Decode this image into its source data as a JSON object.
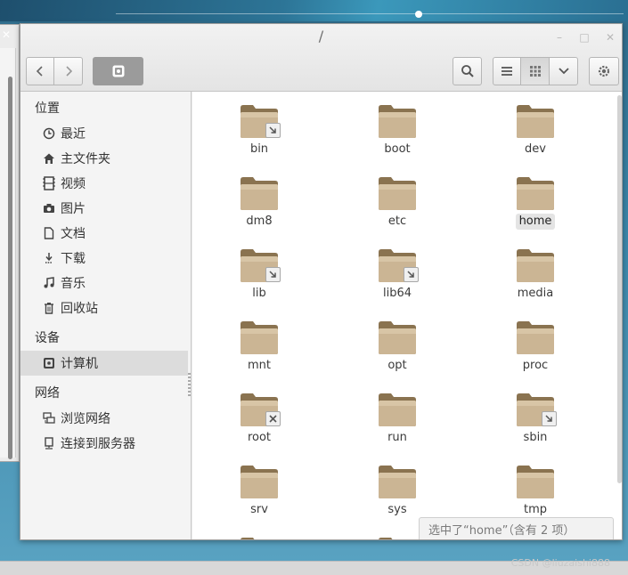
{
  "window": {
    "title": "/"
  },
  "toolbar": {
    "back_icon": "chevron-left-icon",
    "forward_icon": "chevron-right-icon",
    "path_button_icon": "computer-drive-icon",
    "search_icon": "search-icon",
    "list_view_icon": "list-view-icon",
    "grid_view_icon": "grid-view-icon",
    "view_options_icon": "chevron-down-icon",
    "settings_icon": "gear-icon",
    "active_view": "grid"
  },
  "sidebar": {
    "sections": [
      {
        "heading": "位置",
        "items": [
          {
            "label": "最近",
            "icon": "clock-icon"
          },
          {
            "label": "主文件夹",
            "icon": "home-icon"
          },
          {
            "label": "视频",
            "icon": "film-icon"
          },
          {
            "label": "图片",
            "icon": "camera-icon"
          },
          {
            "label": "文档",
            "icon": "document-icon"
          },
          {
            "label": "下载",
            "icon": "download-icon"
          },
          {
            "label": "音乐",
            "icon": "music-icon"
          },
          {
            "label": "回收站",
            "icon": "trash-icon"
          }
        ]
      },
      {
        "heading": "设备",
        "items": [
          {
            "label": "计算机",
            "icon": "computer-drive-icon",
            "selected": true
          }
        ]
      },
      {
        "heading": "网络",
        "items": [
          {
            "label": "浏览网络",
            "icon": "network-icon"
          },
          {
            "label": "连接到服务器",
            "icon": "server-icon"
          }
        ]
      }
    ]
  },
  "files": [
    {
      "name": "bin",
      "emblem": "symlink-icon"
    },
    {
      "name": "boot",
      "emblem": ""
    },
    {
      "name": "dev",
      "emblem": ""
    },
    {
      "name": "dm8",
      "emblem": ""
    },
    {
      "name": "etc",
      "emblem": ""
    },
    {
      "name": "home",
      "emblem": "",
      "selected": true
    },
    {
      "name": "lib",
      "emblem": "symlink-icon"
    },
    {
      "name": "lib64",
      "emblem": "symlink-icon"
    },
    {
      "name": "media",
      "emblem": ""
    },
    {
      "name": "mnt",
      "emblem": ""
    },
    {
      "name": "opt",
      "emblem": ""
    },
    {
      "name": "proc",
      "emblem": ""
    },
    {
      "name": "root",
      "emblem": "unreadable-icon"
    },
    {
      "name": "run",
      "emblem": ""
    },
    {
      "name": "sbin",
      "emblem": "symlink-icon"
    },
    {
      "name": "srv",
      "emblem": ""
    },
    {
      "name": "sys",
      "emblem": ""
    },
    {
      "name": "tmp",
      "emblem": ""
    }
  ],
  "status": {
    "text": "选中了“home”（含有 2 项）"
  },
  "watermark": "CSDN @liuzaishi888"
}
